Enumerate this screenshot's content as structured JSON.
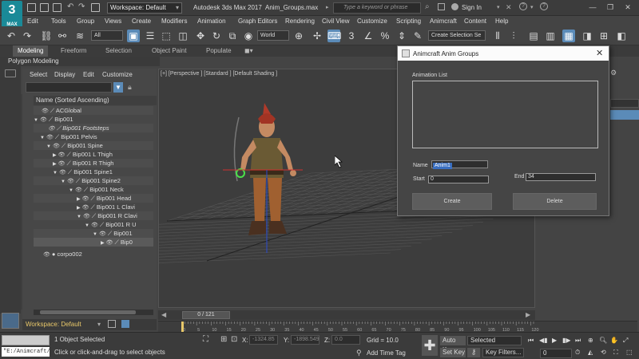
{
  "titlebar": {
    "workspace": "Workspace: Default",
    "app_title": "Autodesk 3ds Max 2017",
    "file_title": "Anim_Groups.max",
    "search_placeholder": "Type a keyword or phrase",
    "sign_in": "Sign In",
    "logo": "3",
    "logo_sub": "MAX"
  },
  "menu": [
    "Edit",
    "Tools",
    "Group",
    "Views",
    "Create",
    "Modifiers",
    "Animation",
    "Graph Editors",
    "Rendering",
    "Civil View",
    "Customize",
    "Scripting",
    "Animcraft",
    "Content",
    "Help"
  ],
  "toolbar": {
    "filter_value": "All",
    "coord_system": "World",
    "selection_set_placeholder": "Create Selection Se"
  },
  "ribbon": {
    "tabs": [
      "Modeling",
      "Freeform",
      "Selection",
      "Object Paint",
      "Populate"
    ],
    "sub_label": "Polygon Modeling"
  },
  "explorer": {
    "menu": [
      "Select",
      "Display",
      "Edit",
      "Customize"
    ],
    "header": "Name (Sorted Ascending)",
    "rows": [
      {
        "label": "ACGlobal"
      },
      {
        "label": "Bip001"
      },
      {
        "label": "Bip001 Footsteps"
      },
      {
        "label": "Bip001 Pelvis"
      },
      {
        "label": "Bip001 Spine"
      },
      {
        "label": "Bip001 L Thigh"
      },
      {
        "label": "Bip001 R Thigh"
      },
      {
        "label": "Bip001 Spine1"
      },
      {
        "label": "Bip001 Spine2"
      },
      {
        "label": "Bip001 Neck"
      },
      {
        "label": "Bip001 Head"
      },
      {
        "label": "Bip001 L Clavi"
      },
      {
        "label": "Bip001 R Clavi"
      },
      {
        "label": "Bip001 R U"
      },
      {
        "label": "Bip001"
      },
      {
        "label": "Bip0"
      },
      {
        "label": "corpo002"
      }
    ],
    "workspace_footer": "Workspace: Default"
  },
  "viewport": {
    "label": "[+] [Perspective ] [Standard ] [Default Shading ]"
  },
  "timeline": {
    "slider": "0 / 121",
    "ticks": [
      "0",
      "5",
      "10",
      "15",
      "20",
      "25",
      "30",
      "35",
      "40",
      "45",
      "50",
      "55",
      "60",
      "65",
      "70",
      "75",
      "80",
      "85",
      "90",
      "95",
      "100",
      "105",
      "110",
      "115",
      "120"
    ]
  },
  "status": {
    "maxscript": "\"E:/Animcraft/",
    "selection": "1 Object Selected",
    "hint": "Click or click-and-drag to select objects",
    "x_label": "X:",
    "x_value": "-1324.85",
    "y_label": "Y:",
    "y_value": "-1898.549",
    "z_label": "Z:",
    "z_value": "0.0",
    "grid": "Grid = 10.0",
    "add_time_tag": "Add Time Tag",
    "auto_key": "Auto Key",
    "set_key": "Set Key",
    "selected": "Selected",
    "key_filters": "Key Filters...",
    "frame": "0"
  },
  "dialog": {
    "title": "Animcraft Anim Groups",
    "list_label": "Animation List",
    "name_label": "Name",
    "name_value": "Anim1",
    "start_label": "Start",
    "start_value": "0",
    "end_label": "End",
    "end_value": "34",
    "create_label": "Create",
    "delete_label": "Delete"
  }
}
